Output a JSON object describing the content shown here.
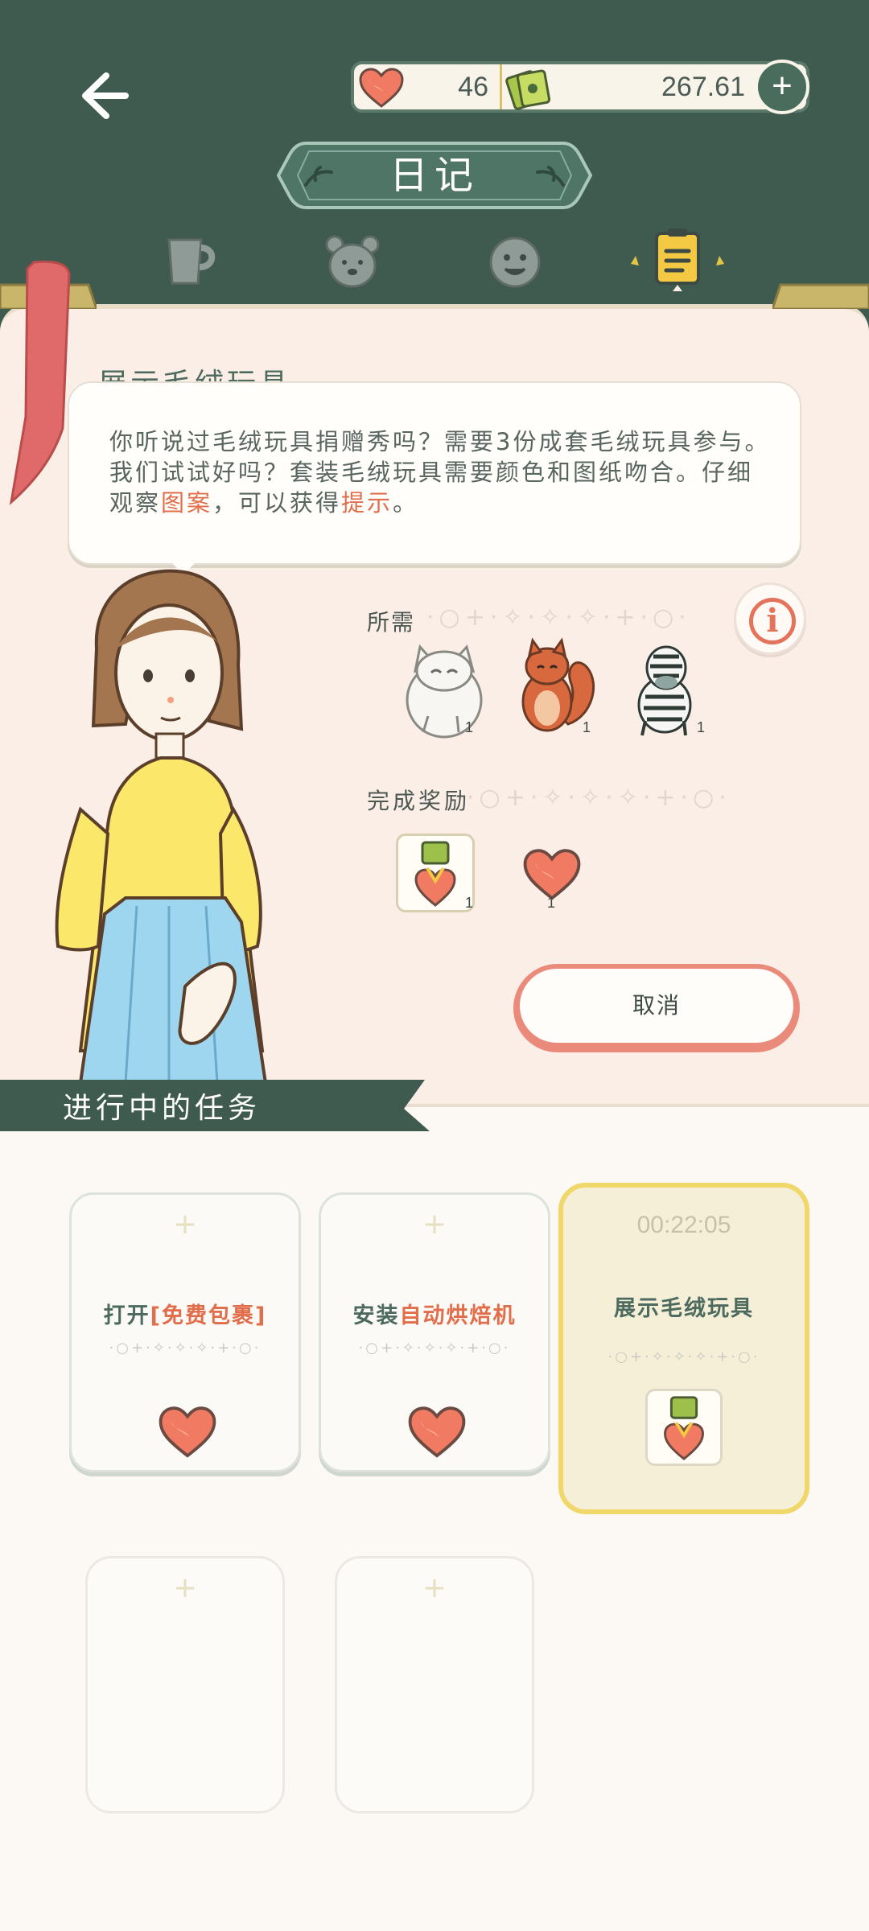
{
  "header": {
    "title": "日记",
    "currency": {
      "hearts": "46",
      "money": "267.61",
      "add_label": "+"
    },
    "tabs": [
      {
        "name": "cup",
        "active": false
      },
      {
        "name": "bear",
        "active": false
      },
      {
        "name": "face",
        "active": false
      },
      {
        "name": "diary",
        "active": true
      }
    ]
  },
  "task": {
    "title": "展示毛绒玩具",
    "desc_part1": "你听说过毛绒玩具捐赠秀吗？需要3份成套毛绒玩具参与。我们试试好吗？套装毛绒玩具需要颜色和图纸吻合。仔细观察",
    "desc_hl1": "图案",
    "desc_part2": "，可以获得",
    "desc_hl2": "提示",
    "desc_part3": "。",
    "required_label": "所需",
    "required_items": [
      {
        "name": "white-cat-plush",
        "qty": "1"
      },
      {
        "name": "squirrel-plush",
        "qty": "1"
      },
      {
        "name": "zebra-plush",
        "qty": "1"
      }
    ],
    "reward_label": "完成奖励",
    "rewards": [
      {
        "name": "heart-gift-badge",
        "qty": "1"
      },
      {
        "name": "heart",
        "qty": "1"
      }
    ],
    "cancel_label": "取消",
    "info_label": "i"
  },
  "in_progress": {
    "label": "进行中的任务",
    "cards": [
      {
        "prefix": "打开",
        "highlight": "[免费包裹]",
        "reward": "heart"
      },
      {
        "prefix": "安装",
        "highlight": "自动烘焙机",
        "reward": "heart"
      },
      {
        "title": "展示毛绒玩具",
        "timer": "00:22:05",
        "reward": "heart-gift-badge",
        "active": true
      }
    ]
  },
  "sparkles": "·○+·✧·✧·✧·+·○·",
  "colors": {
    "primary": "#3f5a4e",
    "accent": "#e26d4a",
    "paper": "#fbeee6",
    "gold": "#f0d76a"
  }
}
